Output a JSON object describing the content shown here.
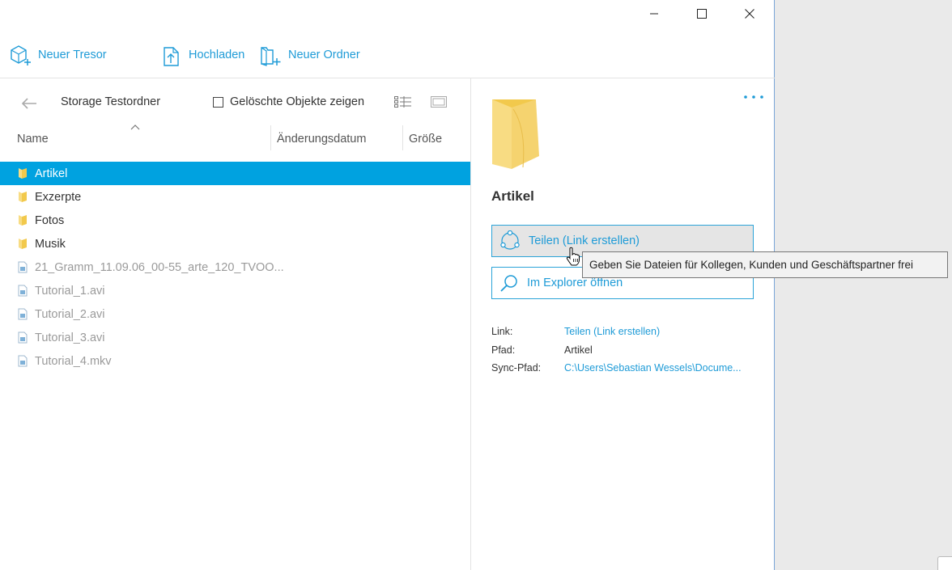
{
  "window": {
    "minimize_icon": "minimize-icon",
    "maximize_icon": "maximize-icon",
    "close_icon": "close-icon"
  },
  "toolbar": {
    "new_vault_label": "Neuer Tresor",
    "upload_label": "Hochladen",
    "new_folder_label": "Neuer Ordner"
  },
  "browser": {
    "breadcrumb": "Storage Testordner",
    "show_deleted_label": "Gelöschte Objekte zeigen",
    "show_deleted_checked": false,
    "columns": [
      "Name",
      "Änderungsdatum",
      "Größe"
    ],
    "files": [
      {
        "name": "Artikel",
        "type": "folder",
        "selected": true
      },
      {
        "name": "Exzerpte",
        "type": "folder",
        "selected": false
      },
      {
        "name": "Fotos",
        "type": "folder",
        "selected": false
      },
      {
        "name": "Musik",
        "type": "folder",
        "selected": false
      },
      {
        "name": "21_Gramm_11.09.06_00-55_arte_120_TVOO...",
        "type": "video",
        "selected": false
      },
      {
        "name": "Tutorial_1.avi",
        "type": "video",
        "selected": false
      },
      {
        "name": "Tutorial_2.avi",
        "type": "video",
        "selected": false
      },
      {
        "name": "Tutorial_3.avi",
        "type": "video",
        "selected": false
      },
      {
        "name": "Tutorial_4.mkv",
        "type": "video",
        "selected": false
      }
    ]
  },
  "details": {
    "title": "Artikel",
    "share_button": "Teilen (Link erstellen)",
    "explorer_button": "Im Explorer öffnen",
    "props": {
      "link_label": "Link:",
      "link_value": "Teilen (Link erstellen)",
      "path_label": "Pfad:",
      "path_value": "Artikel",
      "sync_label": "Sync-Pfad:",
      "sync_value": "C:\\Users\\Sebastian Wessels\\Docume..."
    }
  },
  "tooltip": "Geben Sie Dateien für Kollegen, Kunden und Geschäftspartner frei",
  "colors": {
    "accent": "#1e9bd7",
    "selection": "#00a2e0",
    "folder": "#f5cf62"
  }
}
